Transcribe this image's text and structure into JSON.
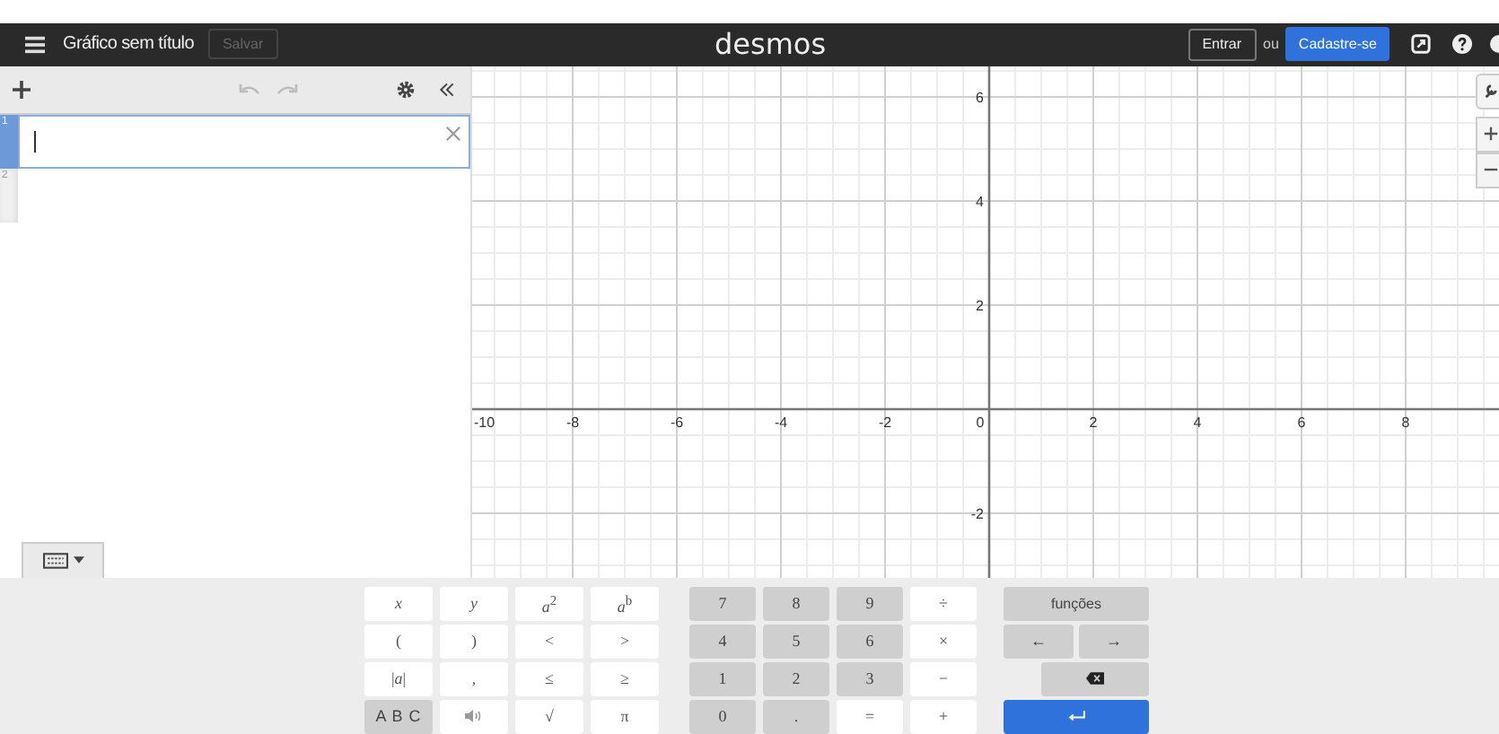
{
  "header": {
    "title": "Gráfico sem título",
    "save_button": {
      "label": "Salvar",
      "disabled": true
    },
    "logo": "desmos",
    "login_button": "Entrar",
    "or_text": "ou",
    "signup_button": "Cadastre-se"
  },
  "expression_toolbar": {
    "undo_disabled": true,
    "redo_disabled": true
  },
  "expressions": [
    {
      "number": "1",
      "selected": true
    },
    {
      "number": "2",
      "selected": false
    }
  ],
  "keyboard_toggle": {
    "on": true
  },
  "graph": {
    "x_labels": [
      "-10",
      "-8",
      "-6",
      "-4",
      "-2",
      "0",
      "2",
      "4",
      "6",
      "8"
    ],
    "y_labels": [
      "6",
      "4",
      "2",
      "-2"
    ]
  },
  "keypad": {
    "blocks": [
      {
        "kind": "math",
        "keys": [
          {
            "kind": "var",
            "label": "x"
          },
          {
            "kind": "var",
            "label": "y"
          },
          {
            "kind": "sym",
            "label": "*a*$^{2}$"
          },
          {
            "kind": "sym",
            "label": "*a*$^{b}$"
          },
          {
            "kind": "sym",
            "label": "("
          },
          {
            "kind": "sym",
            "label": ")"
          },
          {
            "kind": "sym",
            "label": "<"
          },
          {
            "kind": "sym",
            "label": ">"
          },
          {
            "kind": "sym",
            "label": "|*a*|"
          },
          {
            "kind": "sym",
            "label": ","
          },
          {
            "kind": "sym",
            "label": "≤"
          },
          {
            "kind": "sym",
            "label": "≥"
          },
          {
            "kind": "abc",
            "label": "A B C"
          },
          {
            "kind": "speaker"
          },
          {
            "kind": "sym",
            "label": "√"
          },
          {
            "kind": "sym",
            "label": "π"
          }
        ]
      },
      {
        "kind": "numbers",
        "keys": [
          {
            "kind": "num",
            "label": "7"
          },
          {
            "kind": "num",
            "label": "8"
          },
          {
            "kind": "num",
            "label": "9"
          },
          {
            "kind": "sym",
            "label": "÷"
          },
          {
            "kind": "num",
            "label": "4"
          },
          {
            "kind": "num",
            "label": "5"
          },
          {
            "kind": "num",
            "label": "6"
          },
          {
            "kind": "sym",
            "label": "×"
          },
          {
            "kind": "num",
            "label": "1"
          },
          {
            "kind": "num",
            "label": "2"
          },
          {
            "kind": "num",
            "label": "3"
          },
          {
            "kind": "sym",
            "label": "−"
          },
          {
            "kind": "num",
            "label": "0"
          },
          {
            "kind": "num",
            "label": "."
          },
          {
            "kind": "sym",
            "label": "="
          },
          {
            "kind": "sym",
            "label": "+"
          }
        ]
      },
      {
        "kind": "functions",
        "keys": [
          {
            "kind": "wide",
            "label": "funções"
          },
          {
            "kind": "arrow-left",
            "label": "←"
          },
          {
            "kind": "arrow-right",
            "label": "→"
          },
          {
            "kind": "backspace"
          },
          {
            "kind": "enter"
          }
        ]
      }
    ]
  }
}
